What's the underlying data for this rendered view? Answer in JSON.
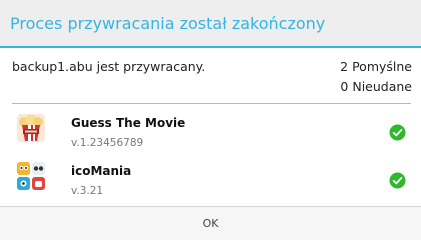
{
  "dialog": {
    "title": "Proces przywracania został zakończony",
    "status_text": "backup1.abu jest przywracany.",
    "success_count": "2 Pomyślne",
    "failed_count": "0 Nieudane",
    "ok_label": "OK",
    "accent_color": "#33b5e5"
  },
  "apps": [
    {
      "name": "Guess The Movie",
      "version": "v.1.23456789",
      "icon": "popcorn-movie-app-icon",
      "status_icon": "check-circle-icon",
      "status_color": "#2eb82e"
    },
    {
      "name": "icoMania",
      "version": "v.3.21",
      "icon": "icomania-app-icon",
      "status_icon": "check-circle-icon",
      "status_color": "#2eb82e"
    }
  ]
}
